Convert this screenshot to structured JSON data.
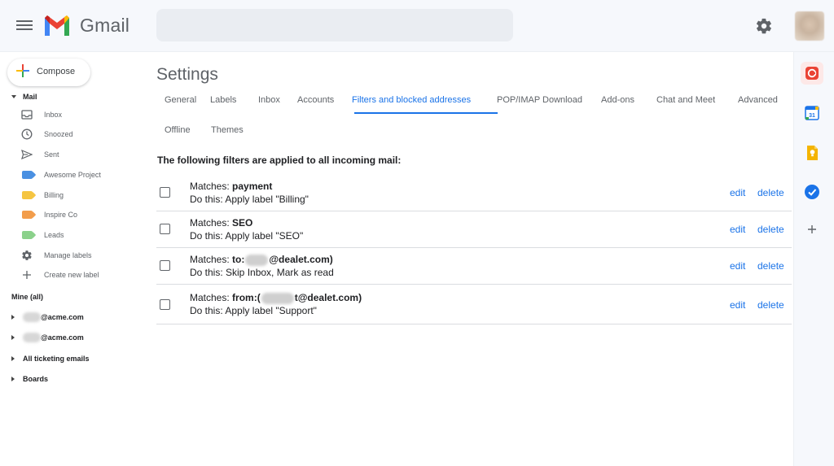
{
  "app": {
    "brand": "Gmail"
  },
  "search": {
    "placeholder": ""
  },
  "compose": {
    "label": "Compose"
  },
  "nav": {
    "mail_header": "Mail",
    "items": [
      {
        "label": "Inbox",
        "icon": "inbox-icon"
      },
      {
        "label": "Snoozed",
        "icon": "clock-icon"
      },
      {
        "label": "Sent",
        "icon": "send-icon"
      },
      {
        "label": "Awesome Project",
        "icon": "label-icon",
        "color": "#4a90e2"
      },
      {
        "label": "Billing",
        "icon": "label-icon",
        "color": "#f5c542"
      },
      {
        "label": "Inspire Co",
        "icon": "label-icon",
        "color": "#f29d4b"
      },
      {
        "label": "Leads",
        "icon": "label-icon",
        "color": "#8bd18b"
      },
      {
        "label": "Manage labels",
        "icon": "gear-icon"
      },
      {
        "label": "Create new label",
        "icon": "plus-icon"
      }
    ],
    "mine_header": "Mine (all)",
    "accounts": [
      {
        "label": "@acme.com"
      },
      {
        "label": "@acme.com"
      },
      {
        "label": "All ticketing emails"
      },
      {
        "label": "Boards"
      }
    ]
  },
  "main": {
    "title": "Settings",
    "tabs": [
      {
        "label": "General"
      },
      {
        "label": "Labels"
      },
      {
        "label": "Inbox"
      },
      {
        "label": "Accounts"
      },
      {
        "label": "Filters and blocked addresses",
        "active": true
      },
      {
        "label": "POP/IMAP Download"
      },
      {
        "label": "Add-ons"
      },
      {
        "label": "Chat and Meet"
      },
      {
        "label": "Advanced"
      },
      {
        "label": "Offline"
      },
      {
        "label": "Themes"
      }
    ],
    "filters_heading": "The following filters are applied to all incoming mail:",
    "filters": [
      {
        "match_prefix": "Matches: ",
        "match_value": "payment",
        "action": "Do this: Apply label \"Billing\""
      },
      {
        "match_prefix": "Matches: ",
        "match_value": "SEO",
        "action": "Do this: Apply label \"SEO\""
      },
      {
        "match_prefix": "Matches: ",
        "match_value_before": "to:",
        "match_value_after": "@dealet.com)",
        "action": "Do this: Skip Inbox, Mark as read"
      },
      {
        "match_prefix": "Matches: ",
        "match_value_before": "from:(",
        "match_value_after": "t@dealet.com)",
        "action": "Do this: Apply label \"Support\""
      }
    ],
    "edit_label": "edit",
    "delete_label": "delete"
  },
  "colors": {
    "accent": "#1a73e8",
    "keep": "#f4b400",
    "calendar": "#1a73e8",
    "tasks": "#1a73e8",
    "contacts_red": "#ea4335"
  }
}
